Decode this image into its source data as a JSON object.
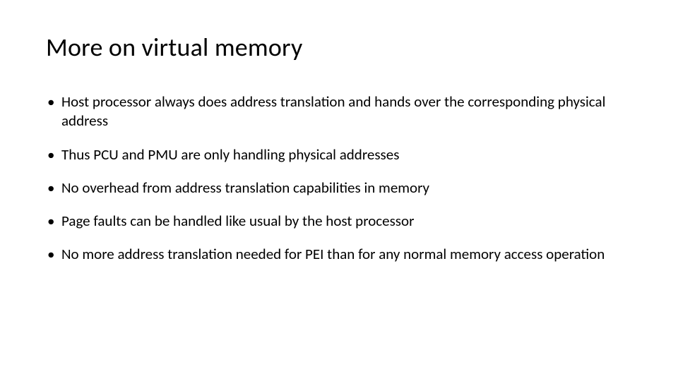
{
  "slide": {
    "title": "More on virtual memory",
    "bullets": [
      "Host processor always does address translation and hands over the corresponding physical address",
      "Thus PCU and PMU are only handling physical addresses",
      "No overhead from address translation capabilities in memory",
      "Page faults can be handled like usual by the host processor",
      "No more address translation needed for PEI than for any normal memory access operation"
    ]
  }
}
